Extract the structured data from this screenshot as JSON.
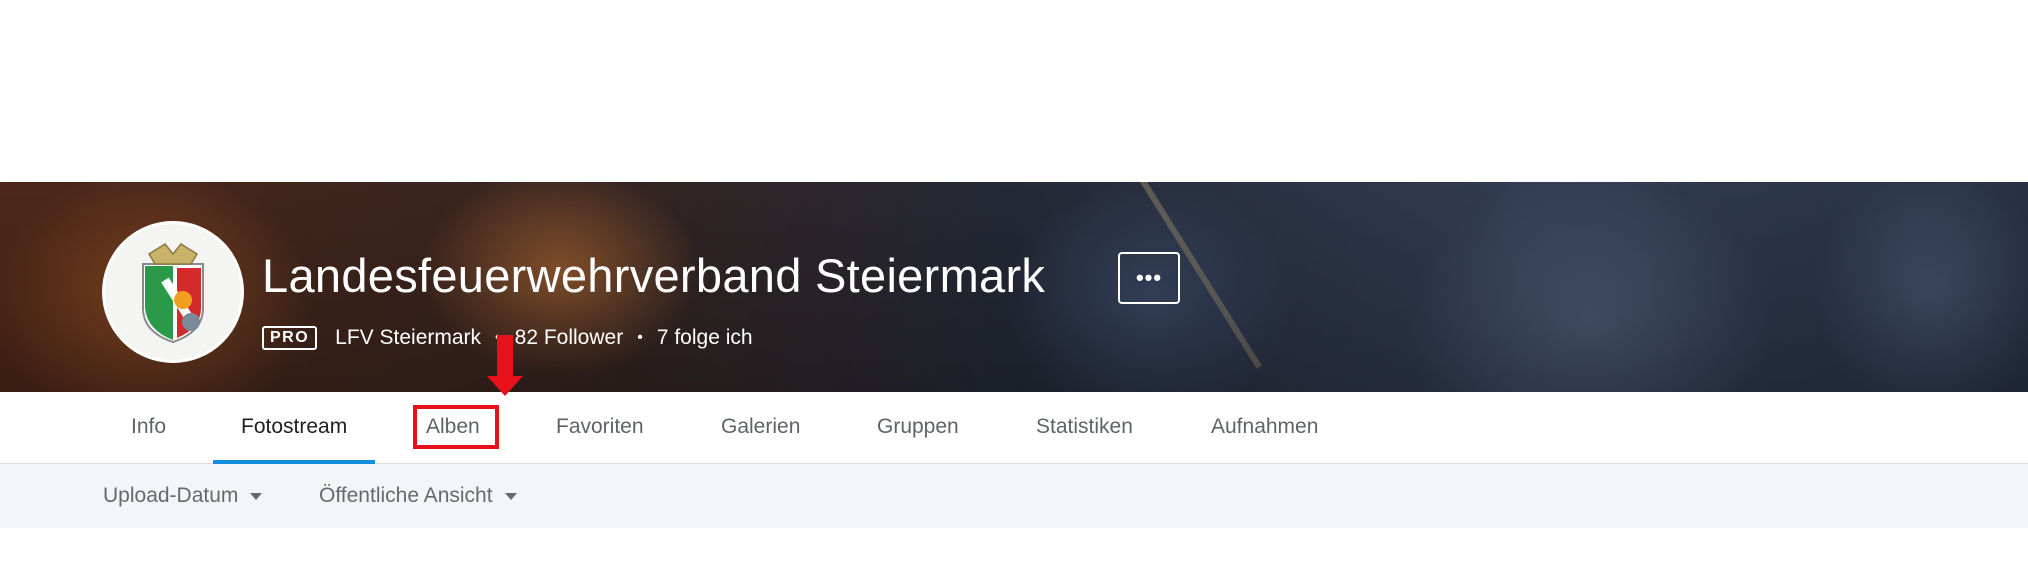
{
  "profile": {
    "title": "Landesfeuerwehrverband Steiermark",
    "badge": "PRO",
    "username": "LFV Steiermark",
    "followers": "82 Follower",
    "following": "7 folge ich",
    "separator": "•",
    "more_label": "•••"
  },
  "tabs": [
    {
      "label": "Info",
      "active": false
    },
    {
      "label": "Fotostream",
      "active": true
    },
    {
      "label": "Alben",
      "active": false,
      "highlighted": true
    },
    {
      "label": "Favoriten",
      "active": false
    },
    {
      "label": "Galerien",
      "active": false
    },
    {
      "label": "Gruppen",
      "active": false
    },
    {
      "label": "Statistiken",
      "active": false
    },
    {
      "label": "Aufnahmen",
      "active": false
    }
  ],
  "filters": {
    "sort": "Upload-Datum",
    "view": "Öffentliche Ansicht"
  },
  "colors": {
    "active_tab_underline": "#128fdc",
    "annotation": "#e8101a"
  },
  "icons": {
    "more": "more-horizontal-icon",
    "dropdown": "caret-down-icon",
    "annotation_arrow": "arrow-down-icon"
  }
}
